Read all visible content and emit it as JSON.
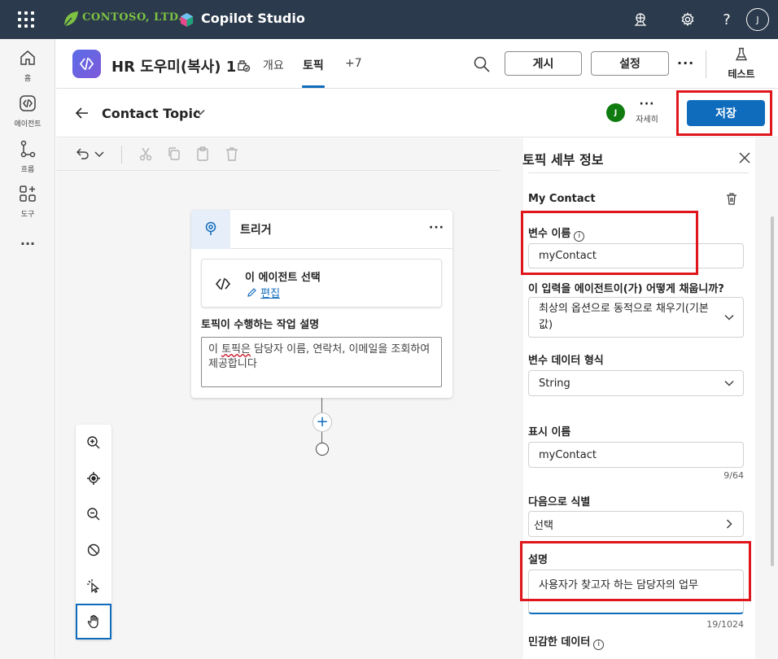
{
  "topbar": {
    "brand": "CONTOSO, LTD.",
    "app_name": "Copilot Studio",
    "avatar_initial": "J"
  },
  "rail": {
    "items": [
      {
        "label": "홈",
        "icon": "home-icon"
      },
      {
        "label": "에이전트",
        "icon": "agents-icon"
      },
      {
        "label": "흐름",
        "icon": "flows-icon"
      },
      {
        "label": "도구",
        "icon": "tools-icon"
      }
    ],
    "more": "···"
  },
  "agent_header": {
    "name": "HR 도우미(복사) 1",
    "tabs": [
      {
        "label": "개요",
        "active": false
      },
      {
        "label": "토픽",
        "active": true
      },
      {
        "label": "+7",
        "active": false
      }
    ],
    "publish_label": "게시",
    "settings_label": "설정",
    "more": "···",
    "test_label": "테스트"
  },
  "topic_row": {
    "title": "Contact Topic",
    "user_initial": "J",
    "more_label": "자세히",
    "more_dots": "···",
    "save_label": "저장"
  },
  "canvas": {
    "trigger_node": {
      "title": "트리거",
      "more": "···",
      "agent_select_title": "이 에이전트 선택",
      "edit_label": "편집",
      "desc_label": "토픽이 수행하는 작업 설명",
      "desc_text_pre": "이 ",
      "desc_text_squiggle": "토픽은",
      "desc_text_post": " 담당자 이름, 연락처, 이메일을 조회하여 제공합니다"
    },
    "add_symbol": "+"
  },
  "panel": {
    "title": "토픽 세부 정보",
    "section_name": "My Contact",
    "var_name_label": "변수 이름",
    "var_name_value": "myContact",
    "fill_label": "이 입력을 에이전트이(가) 어떻게 채웁니까?",
    "fill_value": "최상의 옵션으로 동적으로 채우기(기본값)",
    "format_label": "변수 데이터 형식",
    "format_value": "String",
    "display_label": "표시 이름",
    "display_value": "myContact",
    "display_count": "9/64",
    "identify_label": "다음으로 식별",
    "identify_value": "선택",
    "desc_label": "설명",
    "desc_value": "사용자가 찾고자 하는 담당자의 업무",
    "desc_count": "19/1024",
    "sensitive_label": "민감한 데이터"
  },
  "colors": {
    "topbar": "#2b3a4c",
    "accent": "#0f6cbd",
    "highlight": "#e0161d",
    "brand_green": "#7dc242"
  }
}
